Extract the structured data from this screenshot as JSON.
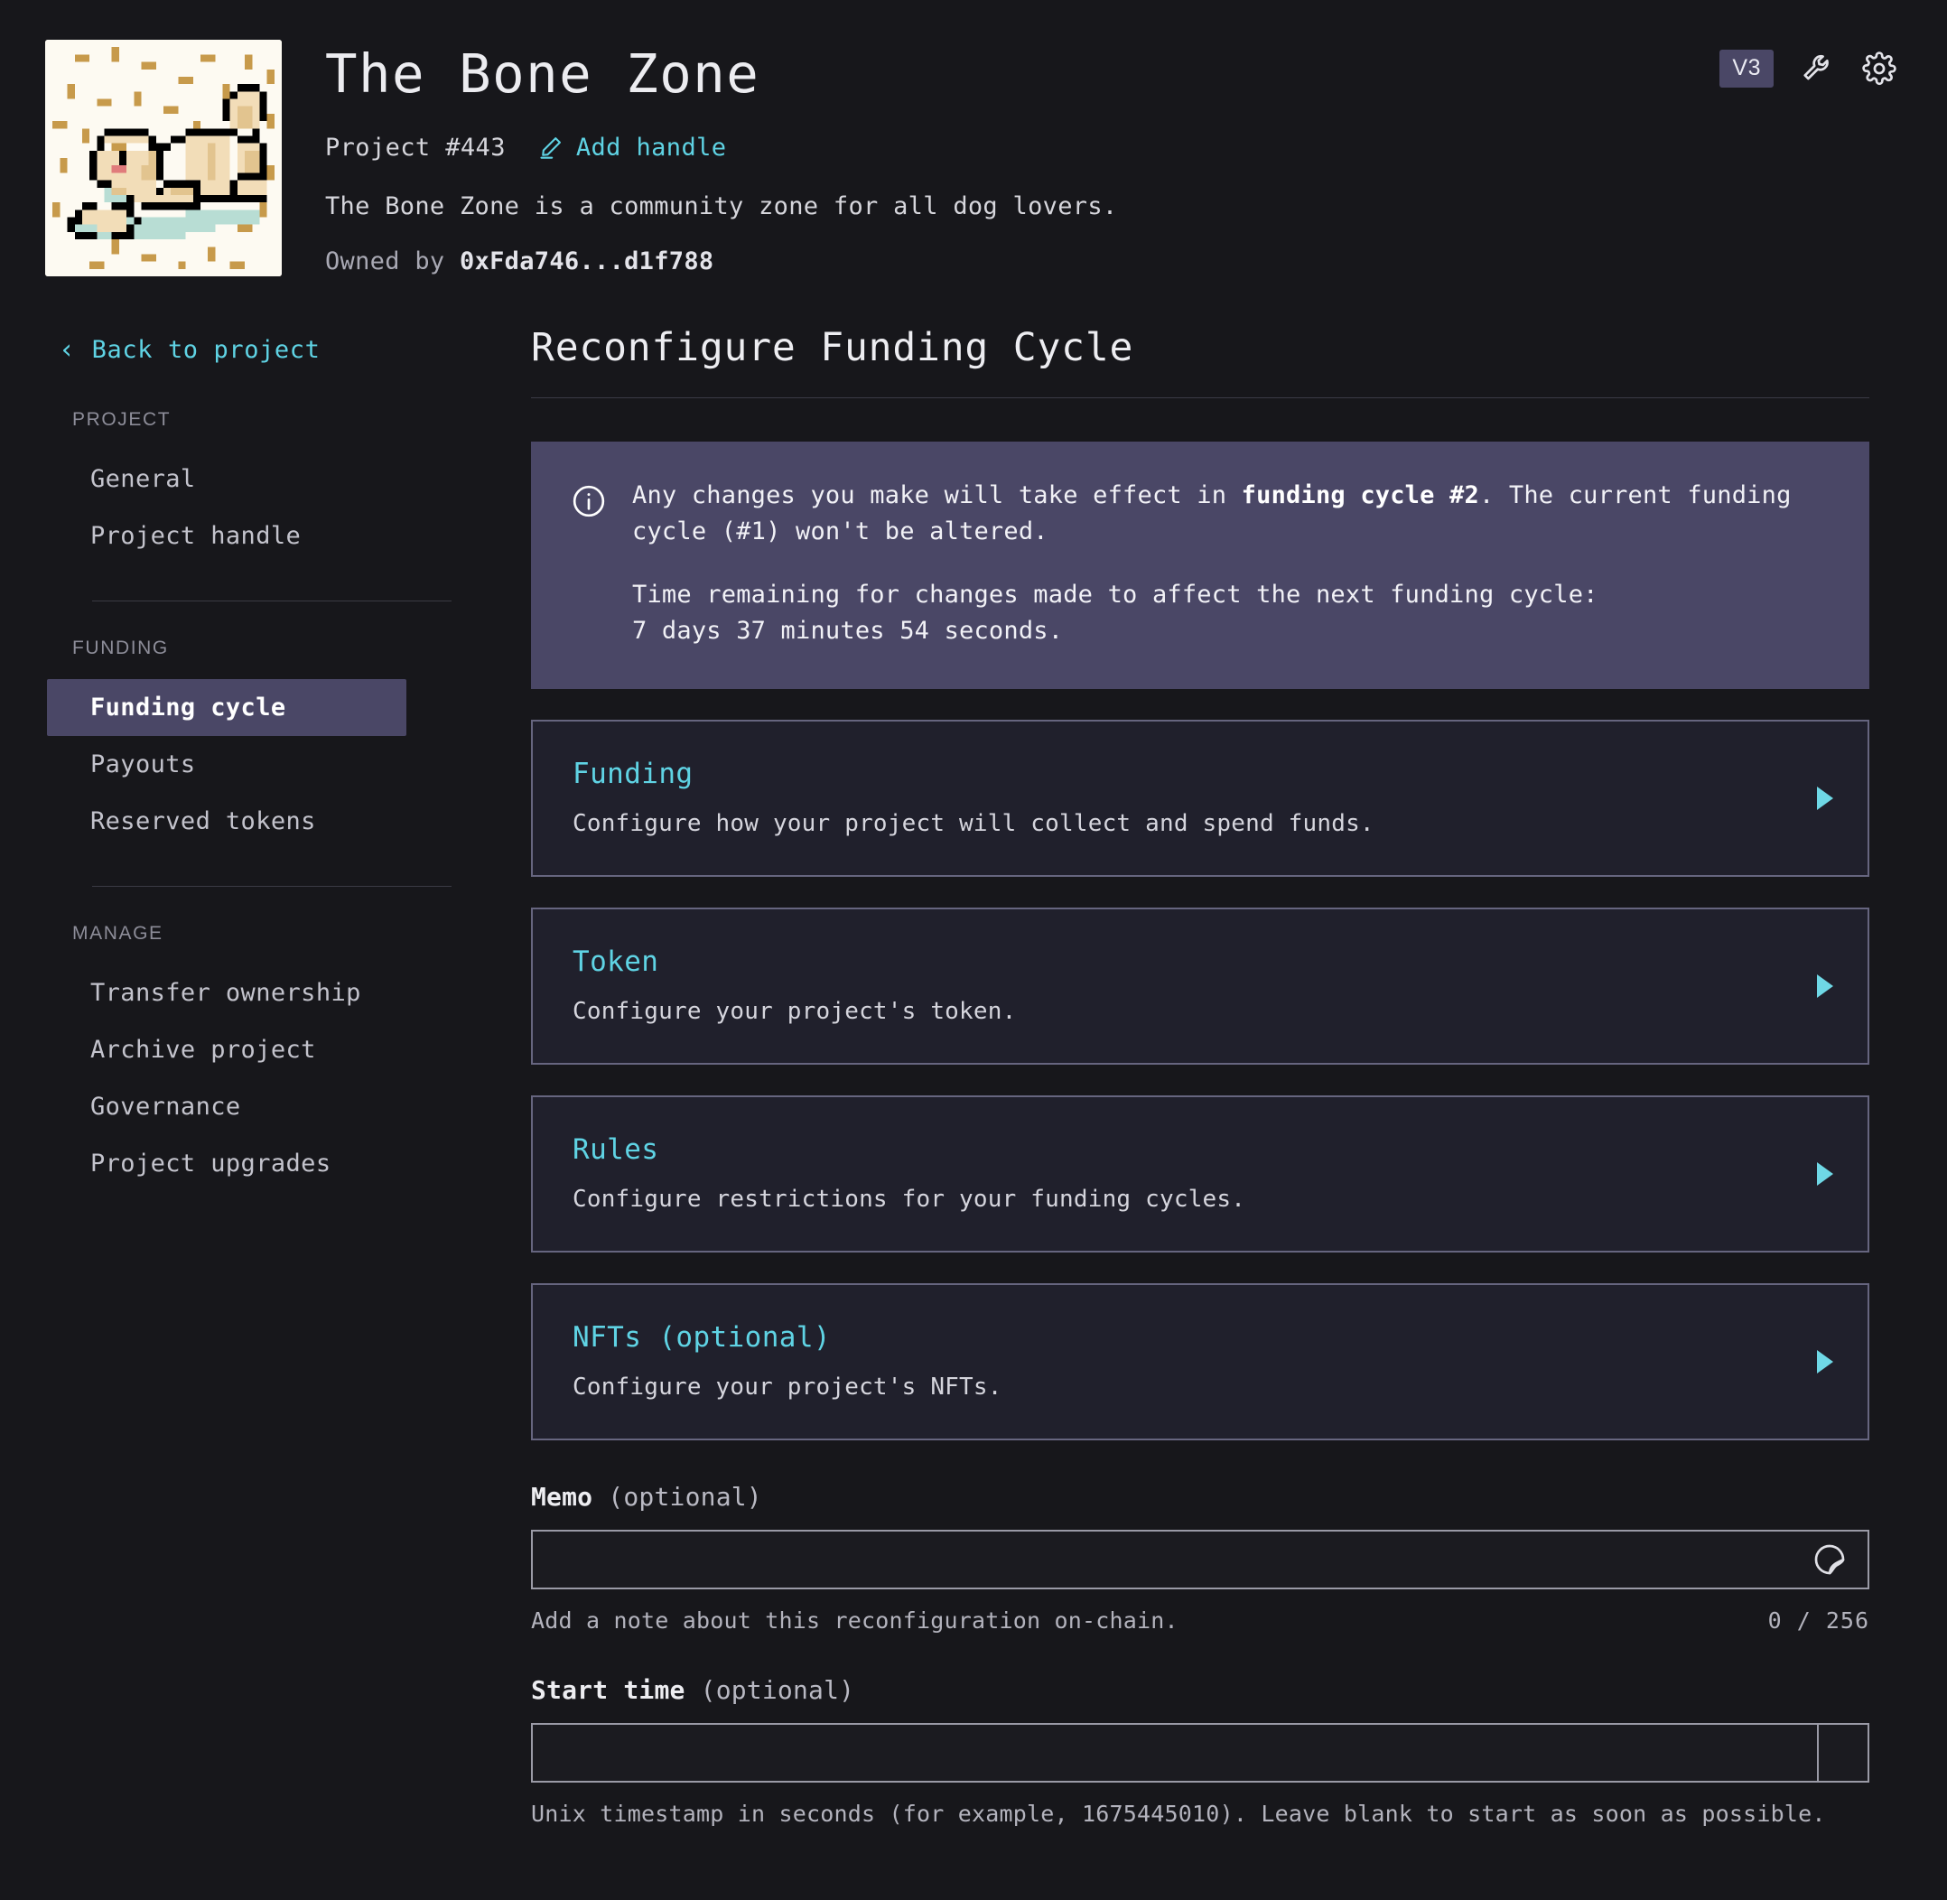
{
  "header": {
    "project_name": "The Bone Zone",
    "project_number": "Project #443",
    "add_handle_label": "Add handle",
    "description": "The Bone Zone is a community zone for all dog lovers.",
    "owned_by_label": "Owned by",
    "owner_address": "0xFda746...d1f788",
    "version_badge": "V3",
    "avatar_alt": "pixel-art golden retriever dog with bone"
  },
  "sidebar": {
    "back_label": "Back to project",
    "groups": [
      {
        "label": "PROJECT",
        "items": [
          {
            "label": "General",
            "active": false
          },
          {
            "label": "Project handle",
            "active": false
          }
        ]
      },
      {
        "label": "FUNDING",
        "items": [
          {
            "label": "Funding cycle",
            "active": true
          },
          {
            "label": "Payouts",
            "active": false
          },
          {
            "label": "Reserved tokens",
            "active": false
          }
        ]
      },
      {
        "label": "MANAGE",
        "items": [
          {
            "label": "Transfer ownership",
            "active": false
          },
          {
            "label": "Archive project",
            "active": false
          },
          {
            "label": "Governance",
            "active": false
          },
          {
            "label": "Project upgrades",
            "active": false
          }
        ]
      }
    ]
  },
  "main": {
    "heading": "Reconfigure Funding Cycle",
    "banner": {
      "line1_a": "Any changes you make will take effect in ",
      "line1_b": "funding cycle #2",
      "line1_c": ". The current funding cycle (#1) won't be altered.",
      "line2": "Time remaining for changes made to affect the next funding cycle:",
      "line3": "7 days 37 minutes 54 seconds."
    },
    "cards": [
      {
        "title": "Funding",
        "desc": "Configure how your project will collect and spend funds."
      },
      {
        "title": "Token",
        "desc": "Configure your project's token."
      },
      {
        "title": "Rules",
        "desc": "Configure restrictions for your funding cycles."
      },
      {
        "title": "NFTs (optional)",
        "desc": "Configure your project's NFTs."
      }
    ],
    "memo": {
      "label_bold": "Memo",
      "label_optional": " (optional)",
      "value": "",
      "placeholder": "",
      "hint": "Add a note about this reconfiguration on-chain.",
      "char_count": "0 / 256"
    },
    "start_time": {
      "label_bold": "Start time",
      "label_optional": " (optional)",
      "value": "",
      "placeholder": "",
      "hint": "Unix timestamp in seconds (for example, 1675445010). Leave blank to start as soon as possible."
    }
  },
  "colors": {
    "background": "#17171b",
    "accent_cyan": "#5fd3e4",
    "accent_purple": "#4a4766",
    "card_bg": "#20202c",
    "card_border": "#66657f"
  }
}
